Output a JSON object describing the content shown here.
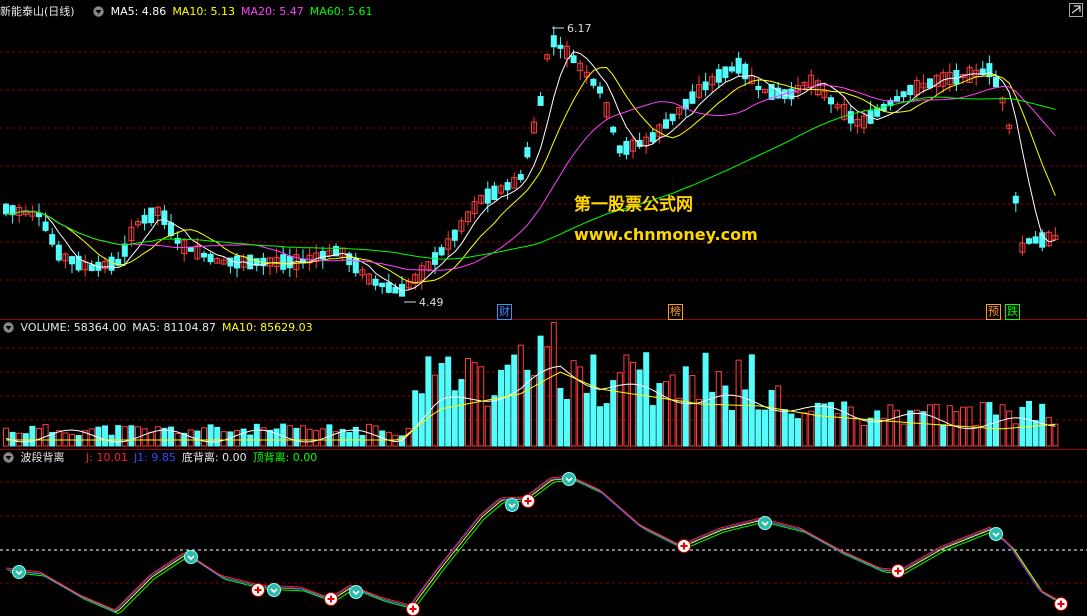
{
  "stock": {
    "name": "新能泰山",
    "period": "(日线)"
  },
  "ma_legend": [
    {
      "label": "MA5: 4.86",
      "color": "#ffffff"
    },
    {
      "label": "MA10: 5.13",
      "color": "#ffff00"
    },
    {
      "label": "MA20: 5.47",
      "color": "#ff40ff"
    },
    {
      "label": "MA60: 5.61",
      "color": "#00ff00"
    }
  ],
  "price_labels": {
    "high": "6.17",
    "low": "4.49"
  },
  "watermark": {
    "line1": "第一股票公式网",
    "line2": "www.chnmoney.com"
  },
  "event_markers": [
    {
      "label": "财",
      "color": "#3b8fff"
    },
    {
      "label": "榜",
      "color": "#ff9933"
    },
    {
      "label": "预",
      "color": "#ff9933"
    },
    {
      "label": "跌",
      "color": "#00ff00"
    }
  ],
  "volume_legend": [
    {
      "label": "VOLUME: 58364.00",
      "color": "#e8e8e8"
    },
    {
      "label": "MA5: 81104.87",
      "color": "#e8e8e8"
    },
    {
      "label": "MA10: 85629.03",
      "color": "#ffff00"
    }
  ],
  "indicator": {
    "title": "波段背离",
    "items": [
      {
        "label": "J: 10.01",
        "color": "#ff2020"
      },
      {
        "label": "J1: 9.85",
        "color": "#3050ff"
      },
      {
        "label": "底背离: 0.00",
        "color": "#e8e8e8"
      },
      {
        "label": "顶背离: 0.00",
        "color": "#00ff00"
      }
    ]
  },
  "colors": {
    "up": "#ff3c3c",
    "down": "#54fcfc",
    "ma5": "#ffffff",
    "ma10": "#ffff00",
    "ma20": "#ff40ff",
    "ma60": "#00ff00",
    "grid": "#8b0000",
    "divider": "#a00000"
  },
  "icons": [
    "collapse-triangle-icon",
    "settings-icon",
    "buy-signal-icon",
    "sell-signal-icon"
  ]
}
